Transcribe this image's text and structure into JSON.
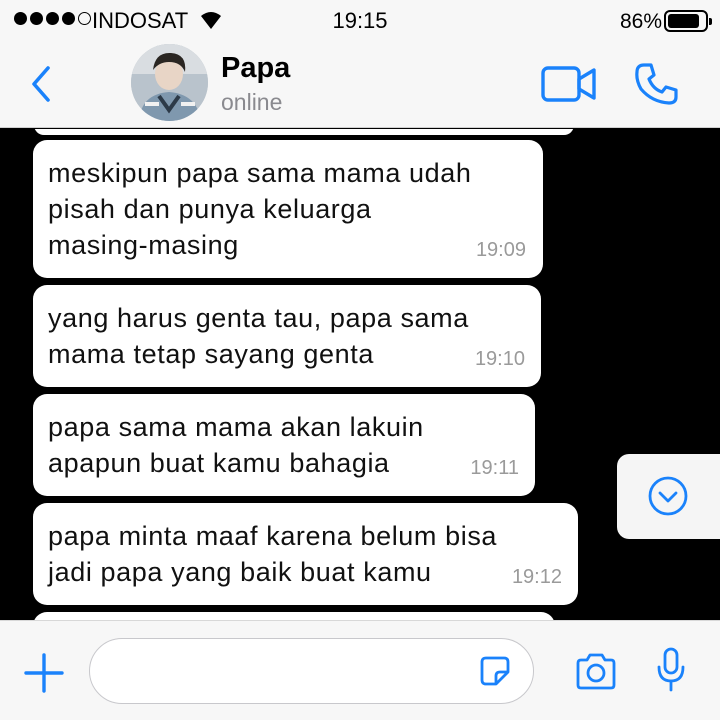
{
  "status_bar": {
    "carrier": "INDOSAT",
    "time": "19:15",
    "battery_percent": "86%",
    "battery_level": 0.86
  },
  "header": {
    "contact_name": "Papa",
    "contact_status": "online",
    "accent_color": "#1a82fb"
  },
  "messages": [
    {
      "text": "meskipun papa sama mama udah\npisah dan punya keluarga\nmasing-masing",
      "time": "19:09"
    },
    {
      "text": "yang harus genta tau, papa sama\nmama tetap sayang genta",
      "time": "19:10"
    },
    {
      "text": "papa sama mama akan lakuin\napapun buat kamu bahagia",
      "time": "19:11"
    },
    {
      "text": "papa minta maaf karena belum bisa\njadi papa yang baik buat kamu",
      "time": "19:12"
    }
  ],
  "icons": {
    "back": "chevron-left-icon",
    "video": "video-camera-icon",
    "phone": "phone-icon",
    "scroll_down": "chevron-down-circle-icon",
    "attach": "plus-icon",
    "sticker": "sticker-icon",
    "camera": "camera-icon",
    "mic": "microphone-icon"
  }
}
